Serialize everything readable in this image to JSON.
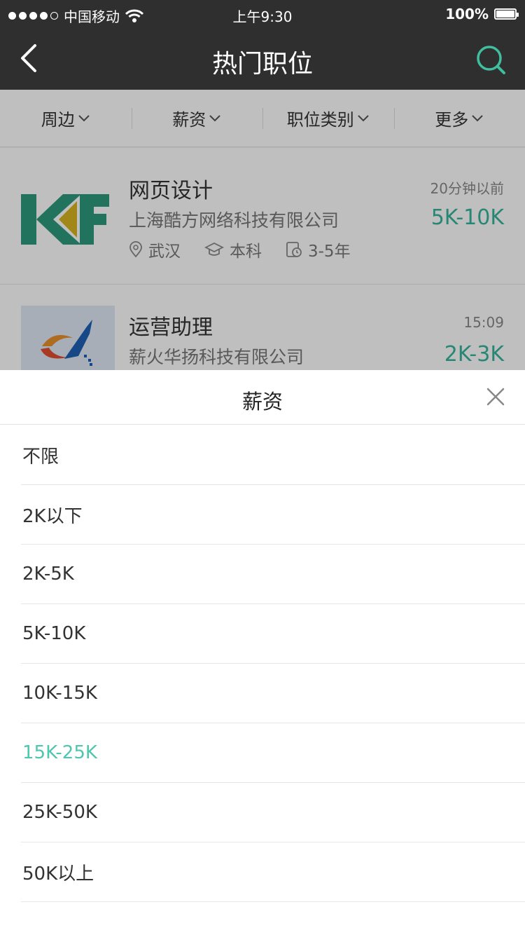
{
  "status_bar": {
    "carrier": "中国移动",
    "time": "上午9:30",
    "battery": "100%"
  },
  "nav": {
    "title": "热门职位",
    "back_icon": "chevron-left-icon",
    "search_icon": "search-icon"
  },
  "filters": [
    {
      "label": "周边"
    },
    {
      "label": "薪资"
    },
    {
      "label": "职位类别"
    },
    {
      "label": "更多"
    }
  ],
  "jobs": [
    {
      "title": "网页设计",
      "company": "上海酷方网络科技有限公司",
      "location": "武汉",
      "education": "本科",
      "experience": "3-5年",
      "time": "20分钟以前",
      "salary": "5K-10K",
      "logo_text": "KF"
    },
    {
      "title": "运营助理",
      "company": "薪火华扬科技有限公司",
      "time": "15:09",
      "salary": "2K-3K"
    }
  ],
  "sheet": {
    "title": "薪资",
    "close_icon": "close-icon",
    "selected_index": 5,
    "options": [
      "不限",
      "2K以下",
      "2K-5K",
      "5K-10K",
      "10K-15K",
      "15K-25K",
      "25K-50K",
      "50K以上"
    ]
  },
  "colors": {
    "accent": "#35b59b",
    "selected": "#4fc6ad",
    "nav_bg": "#2f2f2f"
  }
}
